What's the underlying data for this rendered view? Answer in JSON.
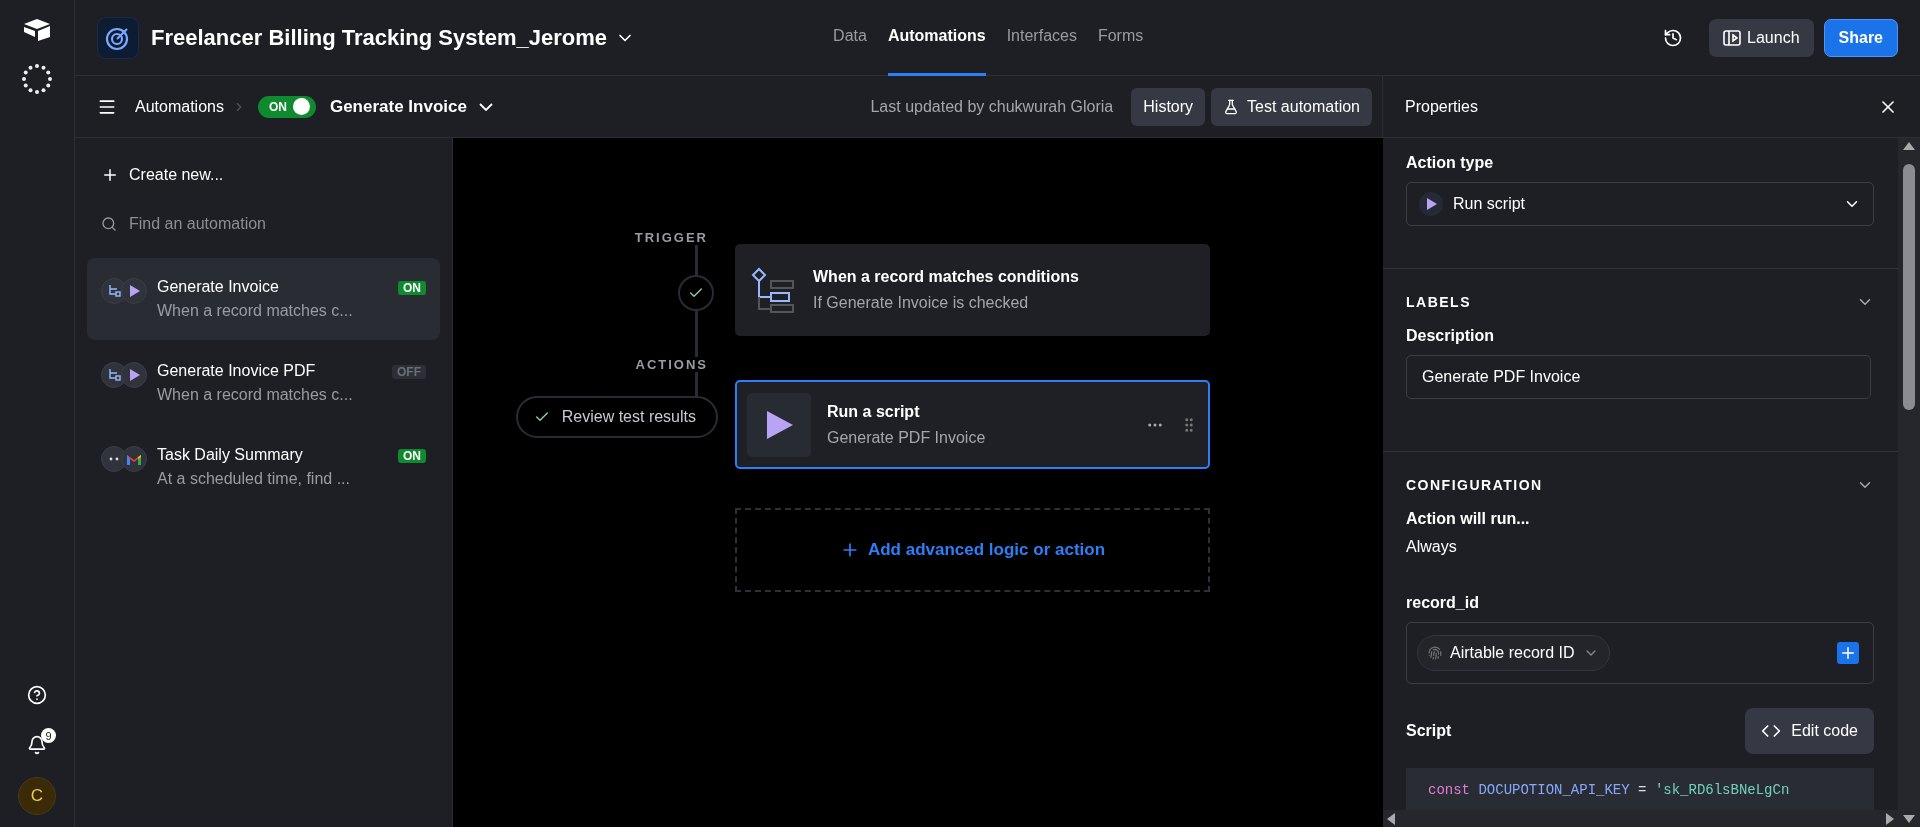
{
  "rail": {
    "notification_count": "9",
    "avatar_initial": "C"
  },
  "base": {
    "title": "Freelancer Billing Tracking System_Jerome"
  },
  "nav_tabs": [
    {
      "label": "Data",
      "selected": false
    },
    {
      "label": "Automations",
      "selected": true
    },
    {
      "label": "Interfaces",
      "selected": false
    },
    {
      "label": "Forms",
      "selected": false
    }
  ],
  "header_buttons": [
    {
      "label": "Launch",
      "kind": "secondary"
    },
    {
      "label": "Share",
      "kind": "primary"
    }
  ],
  "toolbar": {
    "breadcrumb": "Automations",
    "toggle": {
      "label": "ON",
      "on": true
    },
    "automation_name": "Generate Invoice",
    "last_updated": "Last updated by chukwurah Gloria",
    "buttons": [
      {
        "label": "History",
        "kind": "plain"
      },
      {
        "label": "Test automation",
        "kind": "test"
      }
    ]
  },
  "sidebar": {
    "create": "Create new...",
    "search_placeholder": "Find an automation",
    "items": [
      {
        "name": "Generate Invoice",
        "description": "When a record matches c...",
        "status": "ON",
        "on": true,
        "selected": true,
        "icons": [
          {
            "kind": "condition"
          },
          {
            "kind": "script"
          }
        ]
      },
      {
        "name": "Generate Inovice PDF",
        "description": "When a record matches c...",
        "status": "OFF",
        "on": false,
        "selected": false,
        "icons": [
          {
            "kind": "condition"
          },
          {
            "kind": "script"
          }
        ]
      },
      {
        "name": "Task Daily Summary",
        "description": "At a scheduled time, find ...",
        "status": "ON",
        "on": true,
        "selected": false,
        "icons": [
          {
            "kind": "schedule"
          },
          {
            "kind": "email"
          }
        ]
      }
    ]
  },
  "canvas": {
    "trigger_label": "TRIGGER",
    "actions_label": "ACTIONS",
    "review": "Review test results",
    "trigger": {
      "title": "When a record matches conditions",
      "subtitle": "If Generate Invoice is checked"
    },
    "action": {
      "title": "Run a script",
      "subtitle": "Generate PDF Invoice",
      "selected": true
    },
    "add": "Add advanced logic or action"
  },
  "properties": {
    "title": "Properties",
    "action_type_label": "Action type",
    "action_type_value": "Run script",
    "labels_heading": "LABELS",
    "description_label": "Description",
    "description_value": "Generate PDF Invoice",
    "config_heading": "CONFIGURATION",
    "run_label": "Action will run...",
    "run_value": "Always",
    "record_label": "record_id",
    "record_token": "Airtable record ID",
    "script_label": "Script",
    "edit_button": "Edit code",
    "code_tokens": [
      {
        "kind": "keyword",
        "text": "const"
      },
      {
        "kind": "name",
        "text": "DOCUPOTION_API_KEY"
      },
      {
        "kind": "operator",
        "text": "="
      },
      {
        "kind": "string",
        "text": "'sk_RD6lsBNeLgCn"
      }
    ]
  }
}
